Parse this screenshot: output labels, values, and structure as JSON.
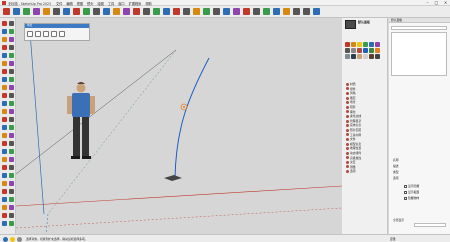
{
  "window": {
    "title": "无标题 - SketchUp Pro 2023",
    "menu": [
      "文件",
      "编辑",
      "视图",
      "镜头",
      "绘图",
      "工具",
      "窗口",
      "扩展程序",
      "帮助"
    ]
  },
  "toolbar": {
    "icon_colors": [
      "#c0392b",
      "#2e6db4",
      "#3a9b4a",
      "#8e44ad",
      "#d68910",
      "#555555",
      "#2e6db4",
      "#c0392b",
      "#3a9b4a",
      "#555555",
      "#2e6db4",
      "#d68910",
      "#8e44ad",
      "#c0392b",
      "#555555",
      "#3a9b4a",
      "#2e6db4",
      "#c0392b",
      "#555555",
      "#d68910",
      "#3a9b4a",
      "#555555",
      "#2e6db4",
      "#8e44ad",
      "#c0392b",
      "#555555",
      "#3a9b4a",
      "#2e6db4",
      "#d68910",
      "#555555",
      "#555555",
      "#2e6db4"
    ]
  },
  "scene_panel": {
    "header": "场景"
  },
  "tray": {
    "title": "默认面板",
    "items": [
      "材质",
      "组件",
      "风格",
      "图层",
      "场景",
      "阴影",
      "雾化",
      "柔化边线",
      "管理目录",
      "实体信息",
      "照片匹配",
      "工具向导",
      "文件",
      "模型信息",
      "地理位置",
      "动态组件",
      "高级属性",
      "交互",
      "测量",
      "选项"
    ]
  },
  "panel": {
    "header": "默认面板",
    "labels": [
      "名称",
      "描述",
      "类型",
      "选项"
    ],
    "checkboxes": [
      "显示隐藏",
      "显示截面",
      "隐藏物体"
    ],
    "footer_label": "全部显示"
  },
  "status": {
    "text_left": "选择对象。切换到扩充选择。拖动鼠标选择多项。",
    "measure_label": "度量"
  },
  "colors": {
    "viewport_bg": "#d6d6d6",
    "axis_green": "#3a8a3a",
    "axis_red": "#c0392b",
    "axis_blue": "#2e6db4",
    "selection": "#2e6db4"
  }
}
